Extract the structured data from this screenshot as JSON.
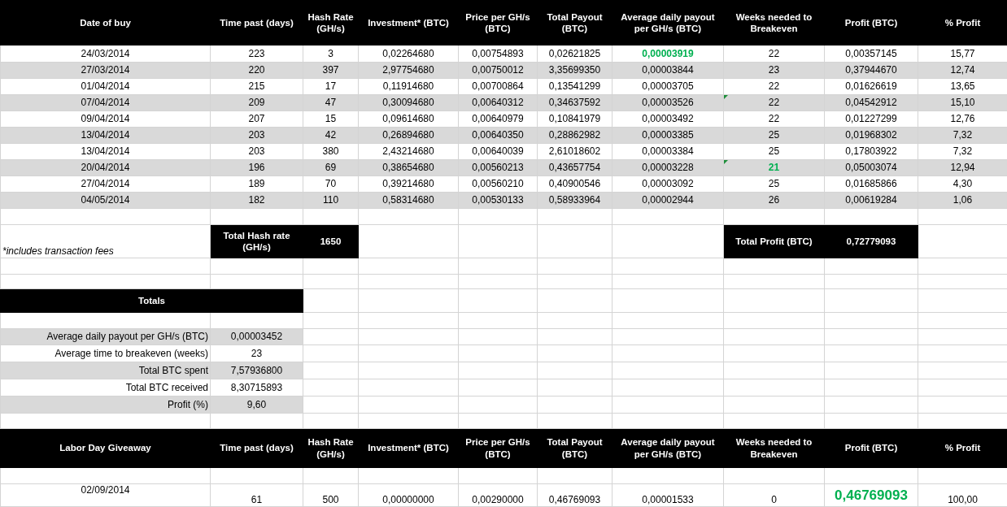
{
  "columns": [
    "Date of buy",
    "Time past (days)",
    "Hash Rate (GH/s)",
    "Investment* (BTC)",
    "Price per GH/s (BTC)",
    "Total Payout (BTC)",
    "Average daily payout per GH/s (BTC)",
    "Weeks needed to Breakeven",
    "Profit (BTC)",
    "% Profit"
  ],
  "rows": [
    {
      "cells": [
        "24/03/2014",
        "223",
        "3",
        "0,02264680",
        "0,00754893",
        "0,02621825",
        "0,00003919",
        "22",
        "0,00357145",
        "15,77"
      ],
      "payout_highlighted": true,
      "weeks_highlighted": false,
      "weeks_flagged": false
    },
    {
      "cells": [
        "27/03/2014",
        "220",
        "397",
        "2,97754680",
        "0,00750012",
        "3,35699350",
        "0,00003844",
        "23",
        "0,37944670",
        "12,74"
      ],
      "payout_highlighted": false,
      "weeks_highlighted": false,
      "weeks_flagged": false
    },
    {
      "cells": [
        "01/04/2014",
        "215",
        "17",
        "0,11914680",
        "0,00700864",
        "0,13541299",
        "0,00003705",
        "22",
        "0,01626619",
        "13,65"
      ],
      "payout_highlighted": false,
      "weeks_highlighted": false,
      "weeks_flagged": false
    },
    {
      "cells": [
        "07/04/2014",
        "209",
        "47",
        "0,30094680",
        "0,00640312",
        "0,34637592",
        "0,00003526",
        "22",
        "0,04542912",
        "15,10"
      ],
      "payout_highlighted": false,
      "weeks_highlighted": false,
      "weeks_flagged": true
    },
    {
      "cells": [
        "09/04/2014",
        "207",
        "15",
        "0,09614680",
        "0,00640979",
        "0,10841979",
        "0,00003492",
        "22",
        "0,01227299",
        "12,76"
      ],
      "payout_highlighted": false,
      "weeks_highlighted": false,
      "weeks_flagged": false
    },
    {
      "cells": [
        "13/04/2014",
        "203",
        "42",
        "0,26894680",
        "0,00640350",
        "0,28862982",
        "0,00003385",
        "25",
        "0,01968302",
        "7,32"
      ],
      "payout_highlighted": false,
      "weeks_highlighted": false,
      "weeks_flagged": false
    },
    {
      "cells": [
        "13/04/2014",
        "203",
        "380",
        "2,43214680",
        "0,00640039",
        "2,61018602",
        "0,00003384",
        "25",
        "0,17803922",
        "7,32"
      ],
      "payout_highlighted": false,
      "weeks_highlighted": false,
      "weeks_flagged": false
    },
    {
      "cells": [
        "20/04/2014",
        "196",
        "69",
        "0,38654680",
        "0,00560213",
        "0,43657754",
        "0,00003228",
        "21",
        "0,05003074",
        "12,94"
      ],
      "payout_highlighted": false,
      "weeks_highlighted": true,
      "weeks_flagged": true
    },
    {
      "cells": [
        "27/04/2014",
        "189",
        "70",
        "0,39214680",
        "0,00560210",
        "0,40900546",
        "0,00003092",
        "25",
        "0,01685866",
        "4,30"
      ],
      "payout_highlighted": false,
      "weeks_highlighted": false,
      "weeks_flagged": false
    },
    {
      "cells": [
        "04/05/2014",
        "182",
        "110",
        "0,58314680",
        "0,00530133",
        "0,58933964",
        "0,00002944",
        "26",
        "0,00619284",
        "1,06"
      ],
      "payout_highlighted": false,
      "weeks_highlighted": false,
      "weeks_flagged": false
    }
  ],
  "footnote": "*includes transaction fees",
  "total_hash_rate": {
    "label": "Total Hash rate (GH/s)",
    "value": "1650"
  },
  "total_profit": {
    "label": "Total Profit (BTC)",
    "value": "0,72779093"
  },
  "totals": {
    "title": "Totals",
    "items": [
      {
        "label": "Average daily payout per GH/s (BTC)",
        "value": "0,00003452"
      },
      {
        "label": "Average time to breakeven (weeks)",
        "value": "23"
      },
      {
        "label": "Total BTC spent",
        "value": "7,57936800"
      },
      {
        "label": "Total BTC received",
        "value": "8,30715893"
      },
      {
        "label": "Profit (%)",
        "value": "9,60"
      }
    ]
  },
  "giveaway": {
    "columns": [
      "Labor Day Giveaway",
      "Time past (days)",
      "Hash Rate (GH/s)",
      "Investment* (BTC)",
      "Price per GH/s (BTC)",
      "Total Payout (BTC)",
      "Average daily payout per GH/s (BTC)",
      "Weeks needed to Breakeven",
      "Profit (BTC)",
      "% Profit"
    ],
    "rows": [
      {
        "cells": [
          "02/09/2014",
          "61",
          "500",
          "0,00000000",
          "0,00290000",
          "0,46769093",
          "0,00001533",
          "0",
          "0,46769093",
          "100,00"
        ],
        "profit_highlighted": true
      }
    ]
  }
}
